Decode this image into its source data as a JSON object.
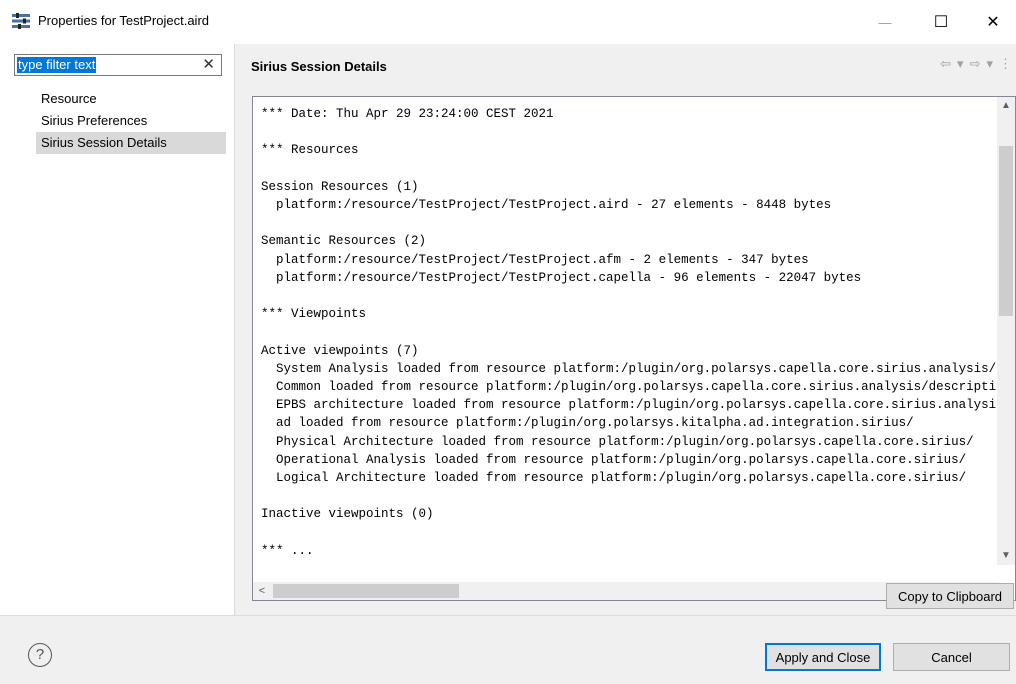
{
  "window": {
    "title": "Properties for TestProject.aird",
    "minimize": "—",
    "maximize": "☐",
    "close": "✕"
  },
  "filter": {
    "value": "type filter text",
    "clear": "✕"
  },
  "tree": {
    "items": [
      {
        "label": "Resource",
        "selected": false
      },
      {
        "label": "Sirius Preferences",
        "selected": false
      },
      {
        "label": "Sirius Session Details",
        "selected": true
      }
    ]
  },
  "section": {
    "title": "Sirius Session Details",
    "nav_back": "⇦",
    "nav_forward": "⇨",
    "dropdown": "▾",
    "menu": "⋮"
  },
  "details": {
    "lines": [
      "*** Date: Thu Apr 29 23:24:00 CEST 2021",
      "",
      "*** Resources",
      "",
      "Session Resources (1)",
      "  platform:/resource/TestProject/TestProject.aird - 27 elements - 8448 bytes",
      "",
      "Semantic Resources (2)",
      "  platform:/resource/TestProject/TestProject.afm - 2 elements - 347 bytes",
      "  platform:/resource/TestProject/TestProject.capella - 96 elements - 22047 bytes",
      "",
      "*** Viewpoints",
      "",
      "Active viewpoints (7)",
      "  System Analysis loaded from resource platform:/plugin/org.polarsys.capella.core.sirius.analysis/description/",
      "  Common loaded from resource platform:/plugin/org.polarsys.capella.core.sirius.analysis/description/",
      "  EPBS architecture loaded from resource platform:/plugin/org.polarsys.capella.core.sirius.analysis/",
      "  ad loaded from resource platform:/plugin/org.polarsys.kitalpha.ad.integration.sirius/",
      "  Physical Architecture loaded from resource platform:/plugin/org.polarsys.capella.core.sirius/",
      "  Operational Analysis loaded from resource platform:/plugin/org.polarsys.capella.core.sirius/",
      "  Logical Architecture loaded from resource platform:/plugin/org.polarsys.capella.core.sirius/",
      "",
      "Inactive viewpoints (0)",
      "",
      "*** ..."
    ]
  },
  "scroll": {
    "up": "▲",
    "down": "▼",
    "left": "<",
    "right": ">"
  },
  "buttons": {
    "copy": "Copy to Clipboard",
    "apply_close": "Apply and Close",
    "cancel": "Cancel",
    "help": "?"
  }
}
